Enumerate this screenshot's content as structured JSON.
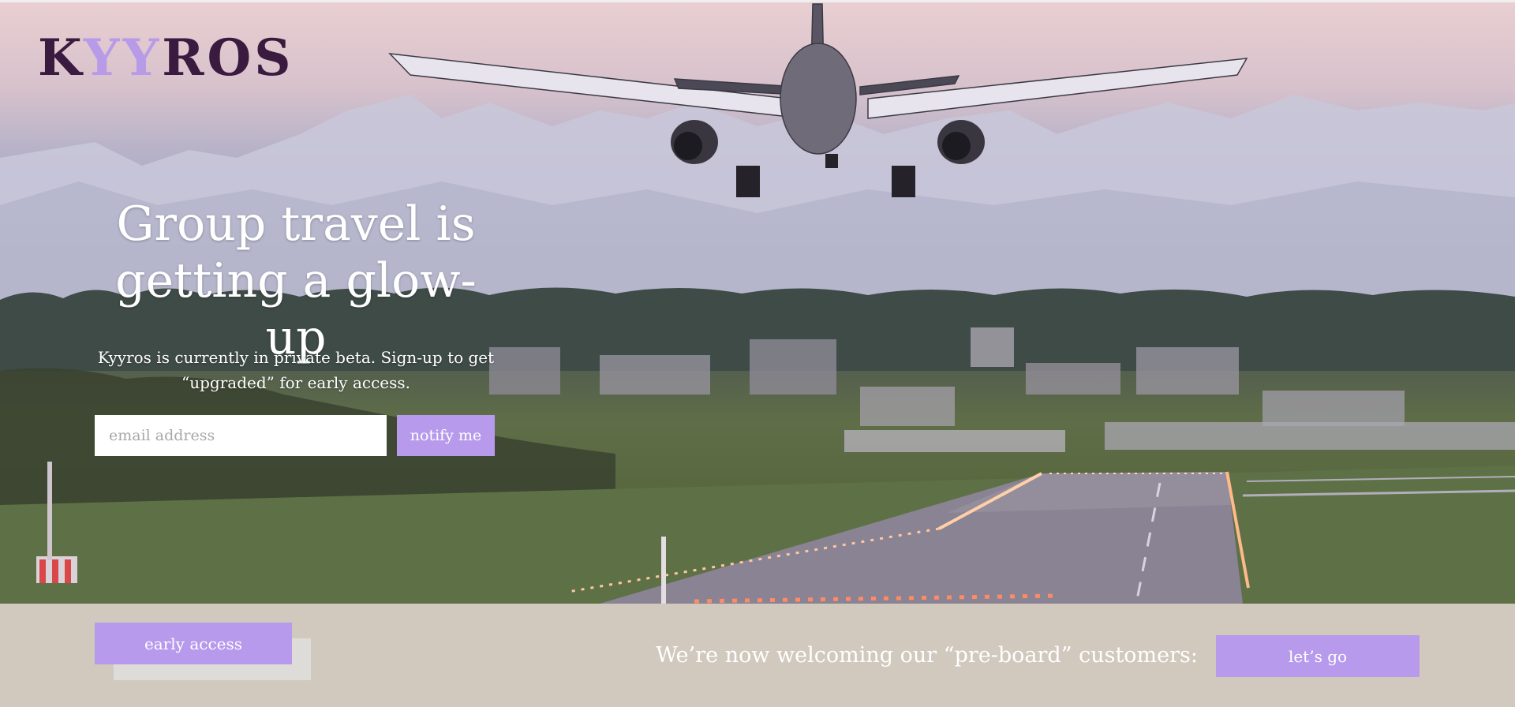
{
  "brand": {
    "logo_text": "KYYROS",
    "colors": {
      "logo": "#3a1a3e",
      "logo_accent": "#b89be8",
      "button": "#b79aec",
      "footer_bg": "#d1c9bd"
    }
  },
  "hero": {
    "background_image": "airplane-landing-runway-mountains-photo",
    "headline": "Group travel is getting a glow-up",
    "subtext": "Kyyros is currently in private beta. Sign-up to get “upgraded” for early access.",
    "email_input": {
      "value": "",
      "placeholder": "email address"
    },
    "notify_label": "notify me"
  },
  "bottom_bar": {
    "early_access_label": "early access",
    "welcome_text": "We’re now welcoming our “pre-board” customers:",
    "lets_go_label": "let’s go"
  }
}
